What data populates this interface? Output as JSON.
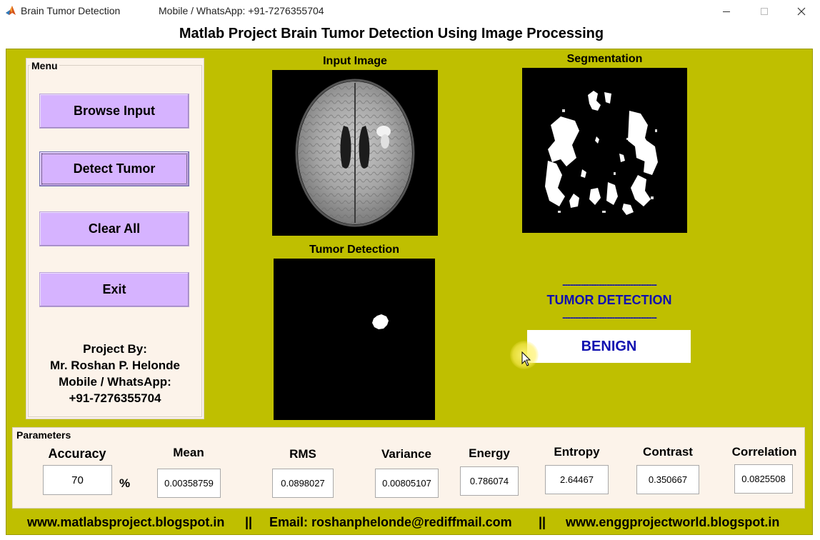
{
  "window": {
    "title": "Brain Tumor Detection",
    "subtitle": "Mobile / WhatsApp: +91-7276355704",
    "icons": {
      "app": "matlab-icon",
      "min": "minimize-icon",
      "max": "maximize-icon",
      "close": "close-icon"
    }
  },
  "heading": "Matlab Project Brain Tumor Detection Using Image Processing",
  "menu": {
    "title": "Menu",
    "buttons": {
      "browse": "Browse Input",
      "detect": "Detect Tumor",
      "clear": "Clear All",
      "exit": "Exit"
    },
    "credits": [
      "Project By:",
      "Mr. Roshan P. Helonde",
      "Mobile / WhatsApp:",
      "+91-7276355704"
    ]
  },
  "panels": {
    "input": "Input Image",
    "segmentation": "Segmentation",
    "detection": "Tumor Detection"
  },
  "result": {
    "dashes": "------------------------------------",
    "label": "TUMOR DETECTION",
    "value": "BENIGN"
  },
  "parameters": {
    "title": "Parameters",
    "accuracy": {
      "label": "Accuracy",
      "value": "70",
      "unit": "%"
    },
    "mean": {
      "label": "Mean",
      "value": "0.00358759"
    },
    "rms": {
      "label": "RMS",
      "value": "0.0898027"
    },
    "variance": {
      "label": "Variance",
      "value": "0.00805107"
    },
    "energy": {
      "label": "Energy",
      "value": "0.786074"
    },
    "entropy": {
      "label": "Entropy",
      "value": "2.64467"
    },
    "contrast": {
      "label": "Contrast",
      "value": "0.350667"
    },
    "correlation": {
      "label": "Correlation",
      "value": "0.0825508"
    }
  },
  "footer": {
    "site1": "www.matlabsproject.blogspot.in",
    "sep": "||",
    "email": "Email: roshanphelonde@rediffmail.com",
    "site2": "www.enggprojectworld.blogspot.in"
  },
  "colors": {
    "panel": "#bfbf00",
    "button": "#d6b3ff",
    "result_text": "#1010b0",
    "menu_bg": "#fcf3ea"
  }
}
